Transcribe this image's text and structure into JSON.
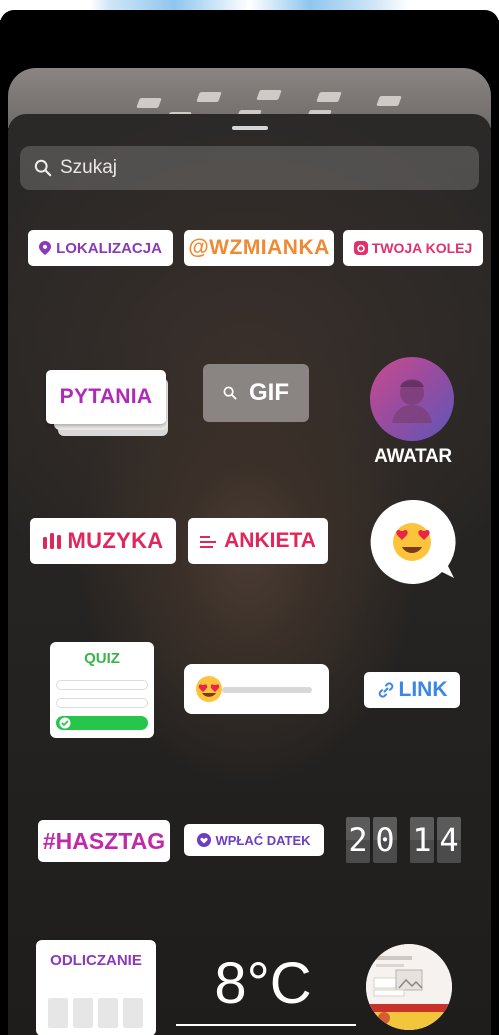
{
  "search": {
    "placeholder": "Szukaj"
  },
  "stickers": {
    "location": "LOKALIZACJA",
    "mention": "@WZMIANKA",
    "your_turn": "TWOJA KOLEJ",
    "questions": "PYTANIA",
    "gif": "GIF",
    "avatar": "AWATAR",
    "music": "MUZYKA",
    "poll": "ANKIETA",
    "quiz": "QUIZ",
    "link": "LINK",
    "hashtag": "#HASZTAG",
    "donate": "WPŁAĆ DATEK",
    "time_hours": "20",
    "time_minutes": "14",
    "countdown": "ODLICZANIE",
    "temperature": "8°C"
  },
  "icons": {
    "search": "search-icon",
    "location": "location-pin-icon",
    "camera": "camera-icon",
    "music": "music-bars-icon",
    "poll": "poll-lines-icon",
    "link": "link-icon",
    "donate": "heart-icon",
    "emoji": "heart-eyes-emoji-icon"
  },
  "colors": {
    "purple": "#8a3ab9",
    "orange": "#f08a32",
    "pink": "#e1306c",
    "magenta": "#b02ab8",
    "red_pink": "#e0265a",
    "blue": "#3a87e6",
    "green": "#39b54a"
  }
}
